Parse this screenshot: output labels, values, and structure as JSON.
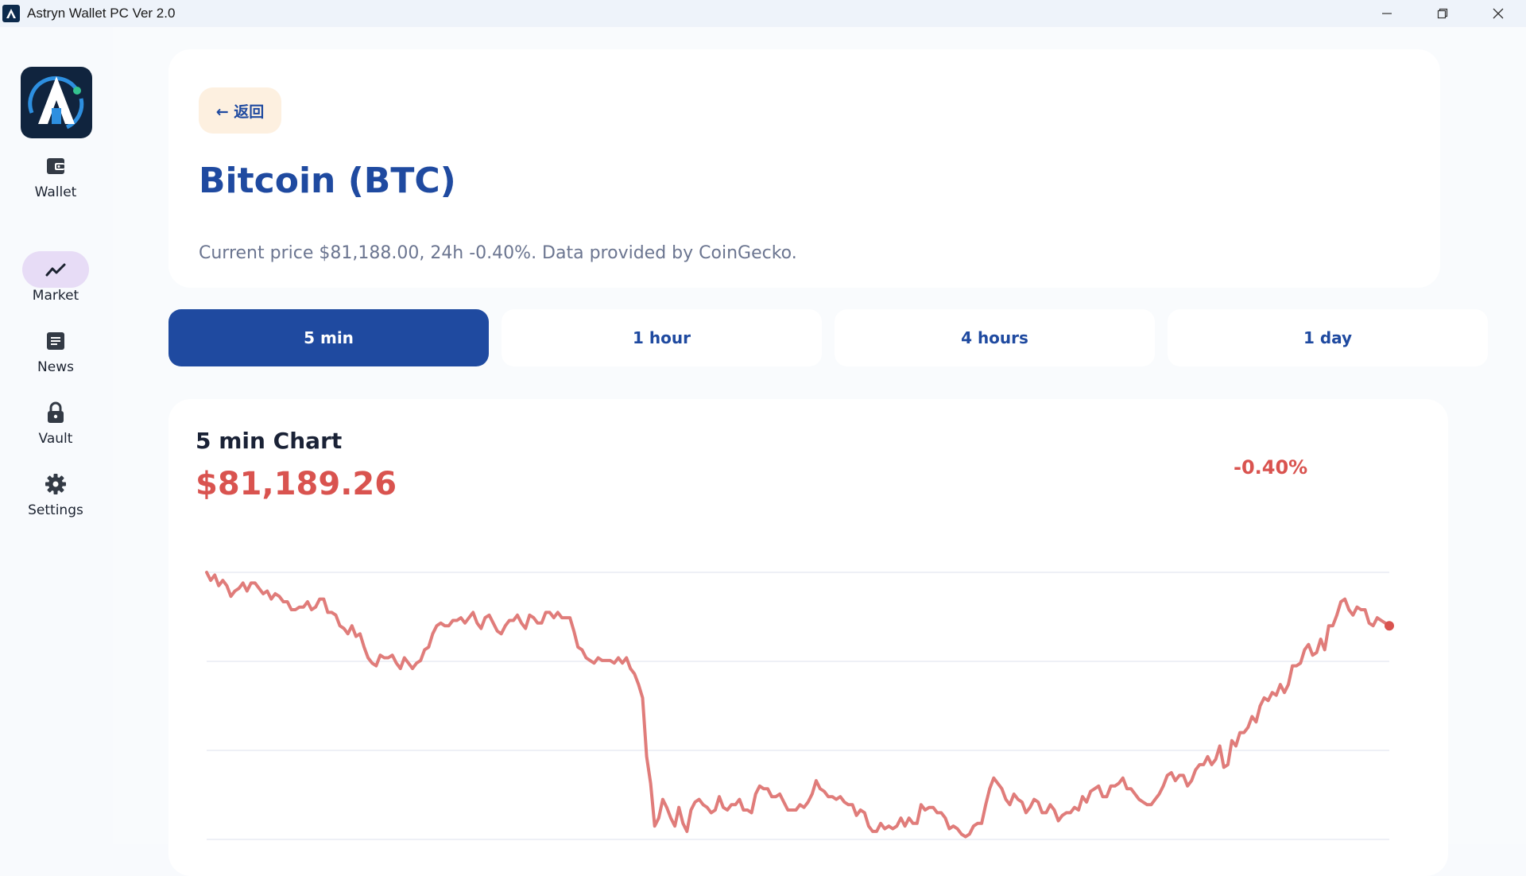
{
  "window": {
    "title": "Astryn Wallet PC Ver 2.0",
    "controls": [
      "minimize-icon",
      "restore-icon",
      "close-icon"
    ]
  },
  "sidebar": {
    "logo_icon": "astryn-logo",
    "items": [
      {
        "label": "Wallet",
        "icon": "wallet-icon",
        "active": false
      },
      {
        "label": "Market",
        "icon": "trend-icon",
        "active": true
      },
      {
        "label": "News",
        "icon": "news-icon",
        "active": false
      },
      {
        "label": "Vault",
        "icon": "lock-icon",
        "active": false
      },
      {
        "label": "Settings",
        "icon": "gear-icon",
        "active": false
      }
    ]
  },
  "header": {
    "back_label": "← 返回",
    "title": "Bitcoin (BTC)",
    "subtitle": "Current price $81,188.00, 24h -0.40%. Data provided by CoinGecko."
  },
  "tabs": [
    {
      "label": "5 min",
      "active": true
    },
    {
      "label": "1 hour",
      "active": false
    },
    {
      "label": "4 hours",
      "active": false
    },
    {
      "label": "1 day",
      "active": false
    }
  ],
  "chart": {
    "title": "5 min Chart",
    "price": "$81,189.26",
    "change": "-0.40%"
  },
  "colors": {
    "accent": "#1f4aa0",
    "negative": "#d9534f",
    "line": "#e07c7a",
    "active_nav": "#e7dcf6"
  },
  "chart_data": {
    "type": "line",
    "title": "5 min Chart",
    "xlabel": "",
    "ylabel": "",
    "grid": true,
    "gridlines": 4,
    "ylim": [
      0,
      100
    ],
    "values": [
      100,
      97,
      99,
      95,
      97,
      95,
      91,
      93,
      94,
      96,
      93,
      96,
      96,
      94,
      92,
      93,
      90,
      92,
      91,
      89,
      89,
      86,
      86,
      87,
      87,
      89,
      86,
      87,
      90,
      90,
      85,
      85,
      84,
      80,
      79,
      77,
      80,
      76,
      77,
      72,
      68,
      66,
      65,
      69,
      68,
      68,
      69,
      66,
      64,
      68,
      66,
      64,
      66,
      67,
      71,
      72,
      77,
      80,
      81,
      80,
      80,
      82,
      82,
      83,
      81,
      83,
      85,
      81,
      79,
      83,
      84,
      81,
      78,
      77,
      80,
      82,
      82,
      84,
      81,
      79,
      84,
      83,
      81,
      81,
      85,
      85,
      83,
      85,
      83,
      83,
      83,
      78,
      72,
      71,
      68,
      67,
      66,
      68,
      67,
      67,
      67,
      66,
      68,
      66,
      68,
      64,
      62,
      58,
      53,
      31,
      21,
      5,
      8,
      15,
      12,
      8,
      5,
      12,
      6,
      3,
      11,
      14,
      15,
      13,
      12,
      10,
      11,
      16,
      12,
      11,
      13,
      13,
      15,
      11,
      11,
      10,
      17,
      20,
      19,
      19,
      16,
      16,
      17,
      14,
      11,
      11,
      11,
      13,
      12,
      14,
      17,
      22,
      19,
      18,
      16,
      16,
      15,
      16,
      14,
      13,
      13,
      9,
      11,
      10,
      5,
      3,
      3,
      6,
      4,
      5,
      4,
      5,
      8,
      5,
      8,
      6,
      6,
      13,
      11,
      12,
      12,
      10,
      10,
      8,
      4,
      5,
      4,
      2,
      1,
      2,
      5,
      6,
      6,
      13,
      19,
      23,
      21,
      19,
      15,
      13,
      17,
      15,
      14,
      10,
      12,
      15,
      14,
      10,
      10,
      13,
      11,
      7,
      9,
      10,
      10,
      12,
      11,
      16,
      14,
      18,
      19,
      20,
      16,
      16,
      20,
      20,
      21,
      23,
      19,
      19,
      17,
      15,
      14,
      13,
      13,
      15,
      17,
      20,
      24,
      25,
      22,
      24,
      24,
      20,
      22,
      26,
      28,
      28,
      31,
      28,
      30,
      35,
      27,
      28,
      37,
      35,
      40,
      40,
      42,
      46,
      44,
      50,
      53,
      52,
      55,
      54,
      58,
      55,
      58,
      65,
      65,
      66,
      71,
      73,
      69,
      70,
      75,
      71,
      80,
      80,
      84,
      89,
      90,
      86,
      84,
      87,
      86,
      86,
      81,
      80,
      83,
      82,
      81,
      80
    ]
  }
}
